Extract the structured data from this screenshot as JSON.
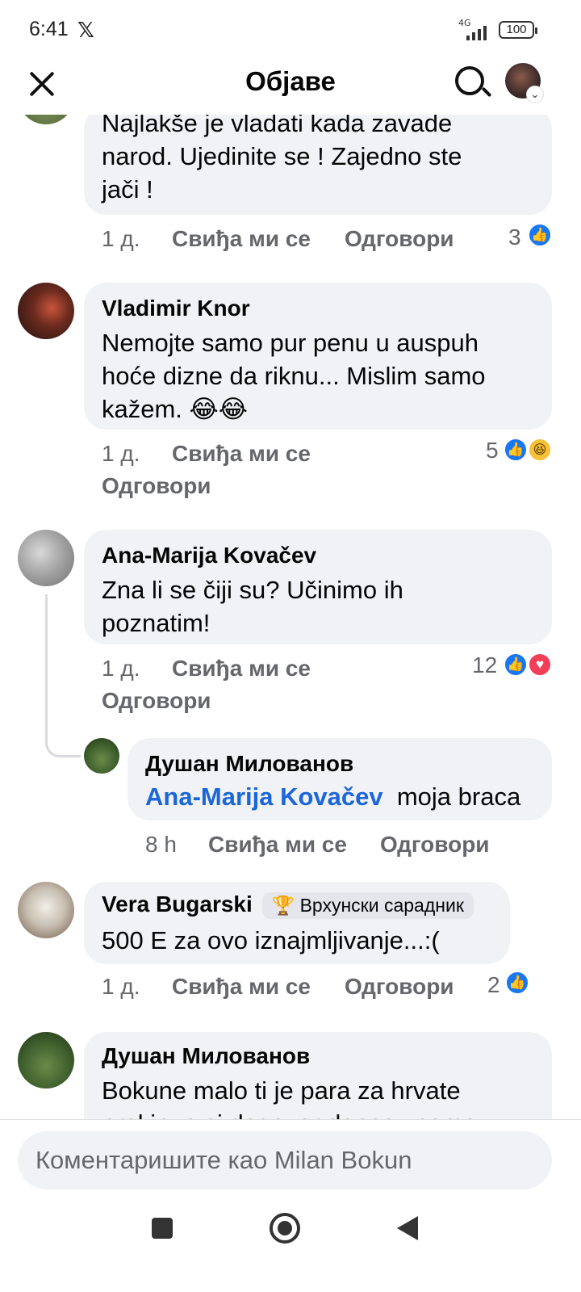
{
  "status_bar": {
    "time": "6:41",
    "network": "4G",
    "battery": "100"
  },
  "header": {
    "title": "Објаве"
  },
  "comments": [
    {
      "author": "",
      "text": "Najlakše je vladati kada zavade narod. Ujedinite se ! Zajedno ste jači !",
      "time": "1 д.",
      "like_label": "Свиђа ми се",
      "reply_label": "Одговори",
      "reaction_count": "3",
      "reactions": [
        "like"
      ]
    },
    {
      "author": "Vladimir Knor",
      "text": "Nemojte samo pur penu u auspuh hoće dizne da riknu... Mislim samo kažem. 😂😂",
      "time": "1 д.",
      "like_label": "Свиђа ми се",
      "reply_label": "Одговори",
      "reaction_count": "5",
      "reactions": [
        "like",
        "haha"
      ]
    },
    {
      "author": "Ana-Marija Kovačev",
      "text": "Zna li se čiji su? Učinimo ih poznatim!",
      "time": "1 д.",
      "like_label": "Свиђа ми се",
      "reply_label": "Одговори",
      "reaction_count": "12",
      "reactions": [
        "like",
        "love"
      ],
      "reply": {
        "author": "Душан Милованов",
        "mention": "Ana-Marija Kovačev",
        "text": "moja braca",
        "time": "8 h",
        "like_label": "Свиђа ми се",
        "reply_label": "Одговори"
      }
    },
    {
      "author": "Vera Bugarski",
      "badge": "Врхунски сарадник",
      "text": "500 E za ovo iznajmljivanje...:(",
      "time": "1 д.",
      "like_label": "Свиђа ми се",
      "reply_label": "Одговори",
      "reaction_count": "2",
      "reactions": [
        "like"
      ]
    },
    {
      "author": "Душан Милованов",
      "text": "Bokune malo ti je para za hrvate prekinuo si dogovor danas znamo"
    }
  ],
  "composer": {
    "placeholder": "Коментаришите као Milan Bokun"
  },
  "colors": {
    "accent": "#1877f2",
    "bubble": "#f0f2f5",
    "meta": "#65676b",
    "mention": "#1b66d8",
    "love": "#f33e58",
    "haha": "#f7c136"
  }
}
